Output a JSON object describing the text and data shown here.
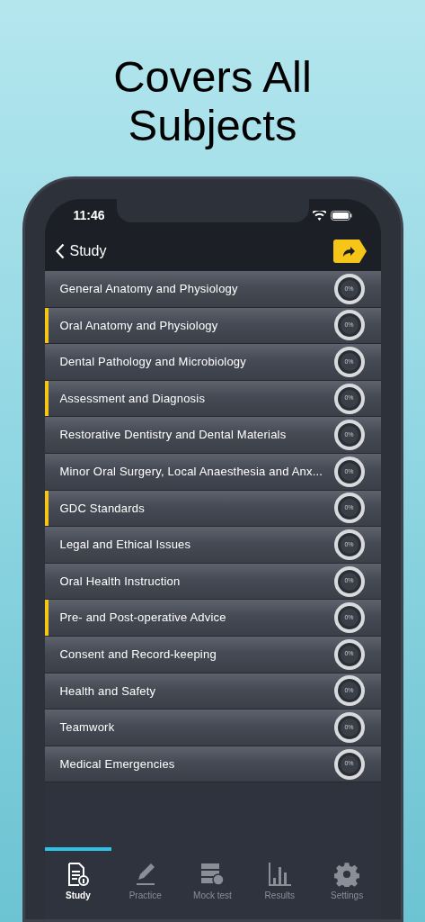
{
  "headline": "Covers All Subjects",
  "status_bar": {
    "time": "11:46"
  },
  "nav": {
    "back_label": "Study"
  },
  "topics": [
    {
      "title": "General Anatomy and Physiology",
      "marked": false,
      "progress": "0%"
    },
    {
      "title": "Oral Anatomy and Physiology",
      "marked": true,
      "progress": "0%"
    },
    {
      "title": "Dental Pathology and Microbiology",
      "marked": false,
      "progress": "0%"
    },
    {
      "title": "Assessment and Diagnosis",
      "marked": true,
      "progress": "0%"
    },
    {
      "title": "Restorative Dentistry and Dental Materials",
      "marked": false,
      "progress": "0%"
    },
    {
      "title": "Minor Oral Surgery, Local Anaesthesia and Anx...",
      "marked": false,
      "progress": "0%"
    },
    {
      "title": "GDC Standards",
      "marked": true,
      "progress": "0%"
    },
    {
      "title": "Legal and Ethical Issues",
      "marked": false,
      "progress": "0%"
    },
    {
      "title": "Oral Health Instruction",
      "marked": false,
      "progress": "0%"
    },
    {
      "title": "Pre- and Post-operative Advice",
      "marked": true,
      "progress": "0%"
    },
    {
      "title": "Consent and Record-keeping",
      "marked": false,
      "progress": "0%"
    },
    {
      "title": "Health and Safety",
      "marked": false,
      "progress": "0%"
    },
    {
      "title": "Teamwork",
      "marked": false,
      "progress": "0%"
    },
    {
      "title": "Medical Emergencies",
      "marked": false,
      "progress": "0%"
    }
  ],
  "tabs": [
    {
      "kind": "study",
      "label": "Study",
      "selected": true
    },
    {
      "kind": "practice",
      "label": "Practice",
      "selected": false
    },
    {
      "kind": "mock",
      "label": "Mock test",
      "selected": false
    },
    {
      "kind": "results",
      "label": "Results",
      "selected": false
    },
    {
      "kind": "settings",
      "label": "Settings",
      "selected": false
    }
  ]
}
